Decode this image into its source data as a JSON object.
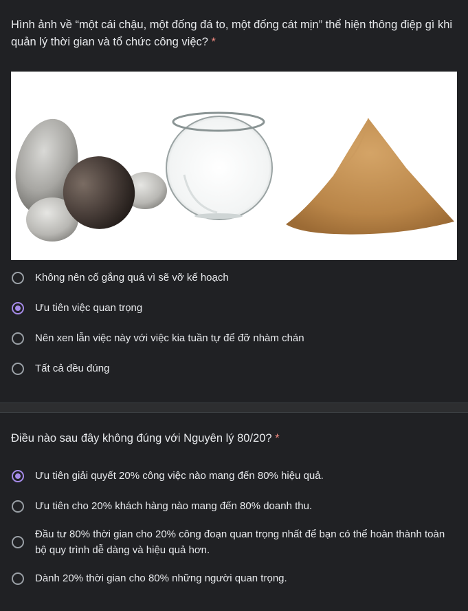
{
  "q1": {
    "text": "Hình ảnh về “một cái chậu, một đống đá to, một đống cát mịn” thể hiện thông điệp gì khi quản lý thời gian và tổ chức công việc?",
    "required_mark": "*",
    "options": [
      {
        "label": "Không nên cố gắng quá vì sẽ vỡ kế hoạch",
        "selected": false
      },
      {
        "label": "Ưu tiên việc quan trọng",
        "selected": true
      },
      {
        "label": "Nên xen lẫn việc này với việc kia tuần tự để đỡ nhàm chán",
        "selected": false
      },
      {
        "label": "Tất cả đều đúng",
        "selected": false
      }
    ]
  },
  "q2": {
    "text": "Điều nào sau đây không đúng với Nguyên lý 80/20?",
    "required_mark": "*",
    "options": [
      {
        "label": "Ưu tiên giải quyết 20% công việc nào mang đến 80% hiệu quả.",
        "selected": true
      },
      {
        "label": "Ưu tiên cho 20% khách hàng nào mang đến 80% doanh thu.",
        "selected": false
      },
      {
        "label": "Đầu tư 80% thời gian cho 20% công đoạn quan trọng nhất để bạn có thể hoàn thành toàn bộ quy trình dễ dàng và hiệu quả hơn.",
        "selected": false
      },
      {
        "label": "Dành 20% thời gian cho 80% những người quan trọng.",
        "selected": false
      }
    ]
  },
  "colors": {
    "accent": "#a58ae8",
    "required": "#f28b82",
    "background": "#202124"
  }
}
